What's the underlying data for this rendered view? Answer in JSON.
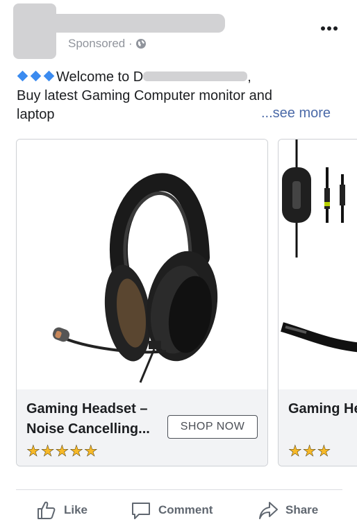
{
  "post": {
    "sponsored_label": "Sponsored ·",
    "caption_line1": "Welcome to D",
    "caption_line1_suffix": ",",
    "caption_line2": "Buy latest Gaming Computer monitor and",
    "caption_line3": "laptop",
    "see_more": "...see more"
  },
  "carousel": {
    "cards": [
      {
        "title": "Gaming Headset – Noise Cancelling...",
        "rating": 5,
        "stars_text": "★★★★★",
        "cta": "SHOP NOW"
      },
      {
        "title": "Gaming Headph",
        "stars_text": "★★★"
      }
    ]
  },
  "actions": {
    "like": "Like",
    "comment": "Comment",
    "share": "Share"
  },
  "icons": [
    "globe-icon",
    "more-options-icon",
    "diamond-icon",
    "like-icon",
    "comment-icon",
    "share-icon",
    "star-icon"
  ],
  "colors": {
    "link": "#4b6aa8",
    "star": "#f7b928",
    "diamond": "#3b8bf0",
    "muted": "#606770"
  }
}
